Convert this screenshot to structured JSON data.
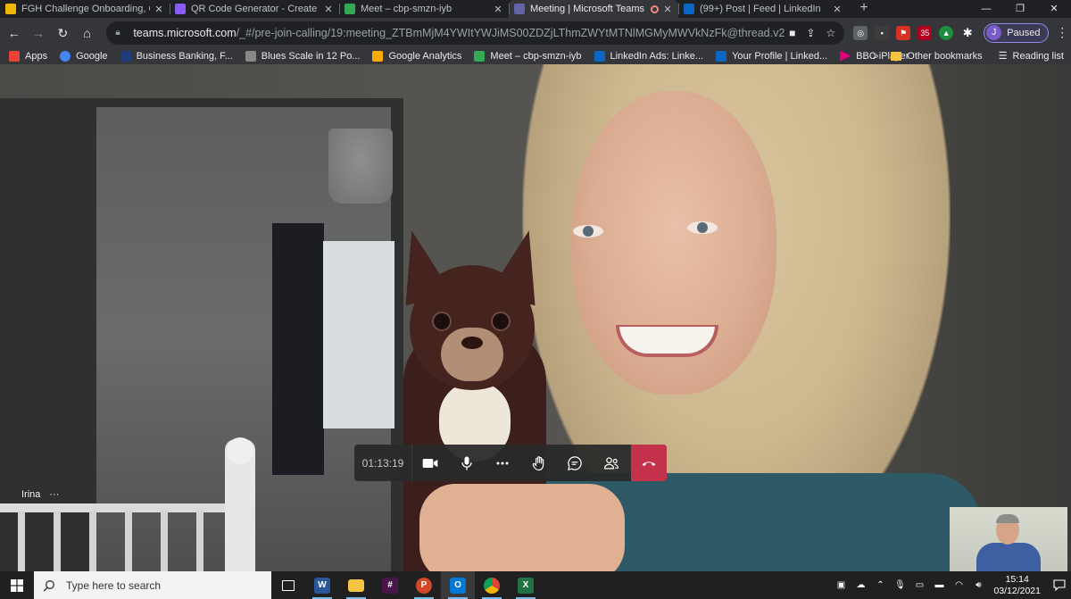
{
  "browser": {
    "tabs": [
      {
        "title": "FGH Challenge Onboarding, Onli",
        "favicon_color": "#f2b705",
        "active": false,
        "recording": false
      },
      {
        "title": "QR Code Generator - Create Fan",
        "favicon_color": "#8a5cf6",
        "active": false,
        "recording": false
      },
      {
        "title": "Meet – cbp-smzn-iyb",
        "favicon_color": "#34a853",
        "active": false,
        "recording": false
      },
      {
        "title": "Meeting | Microsoft Teams",
        "favicon_color": "#6264a7",
        "active": true,
        "recording": true
      },
      {
        "title": "(99+) Post | Feed | LinkedIn",
        "favicon_color": "#0a66c2",
        "active": false,
        "recording": false
      }
    ],
    "url_host": "teams.microsoft.com",
    "url_path": "/_#/pre-join-calling/19:meeting_ZTBmMjM4YWItYWJiMS00ZDZjLThmZWYtMTNlMGMyMWVkNzFk@thread.v2",
    "profile_initial": "J",
    "profile_status": "Paused",
    "ext_badge": "35"
  },
  "bookmarks": {
    "items": [
      {
        "label": "Apps",
        "color": "#ea4335"
      },
      {
        "label": "Google",
        "color": "#4285f4"
      },
      {
        "label": "Business Banking, F...",
        "color": "#1f3d7a"
      },
      {
        "label": "Blues Scale in 12 Po...",
        "color": "#888888"
      },
      {
        "label": "Google Analytics",
        "color": "#f9ab00"
      },
      {
        "label": "Meet – cbp-smzn-iyb",
        "color": "#34a853"
      },
      {
        "label": "LinkedIn Ads: Linke...",
        "color": "#0a66c2"
      },
      {
        "label": "Your Profile | Linked...",
        "color": "#0a66c2"
      },
      {
        "label": "BBC iPlayer",
        "color": "#e6007e"
      }
    ],
    "more": "»",
    "other": "Other bookmarks",
    "reading_list": "Reading list"
  },
  "meeting": {
    "participant_name": "Irina",
    "participant_more": "···",
    "timer": "01:13:19",
    "hangup_color": "#c4314b"
  },
  "taskbar": {
    "search_placeholder": "Type here to search",
    "time": "15:14",
    "date": "03/12/2021",
    "apps": [
      {
        "name": "task-view",
        "label": "",
        "color": "#202020"
      },
      {
        "name": "word",
        "label": "W",
        "color": "#2b579a"
      },
      {
        "name": "file-explorer",
        "label": "",
        "color": "#f4c542"
      },
      {
        "name": "slack",
        "label": "#",
        "color": "#4a154b"
      },
      {
        "name": "powerpoint",
        "label": "P",
        "color": "#d24726"
      },
      {
        "name": "outlook",
        "label": "O",
        "color": "#0078d4"
      },
      {
        "name": "chrome",
        "label": "",
        "color": "#db4437"
      },
      {
        "name": "excel",
        "label": "X",
        "color": "#217346"
      }
    ]
  }
}
